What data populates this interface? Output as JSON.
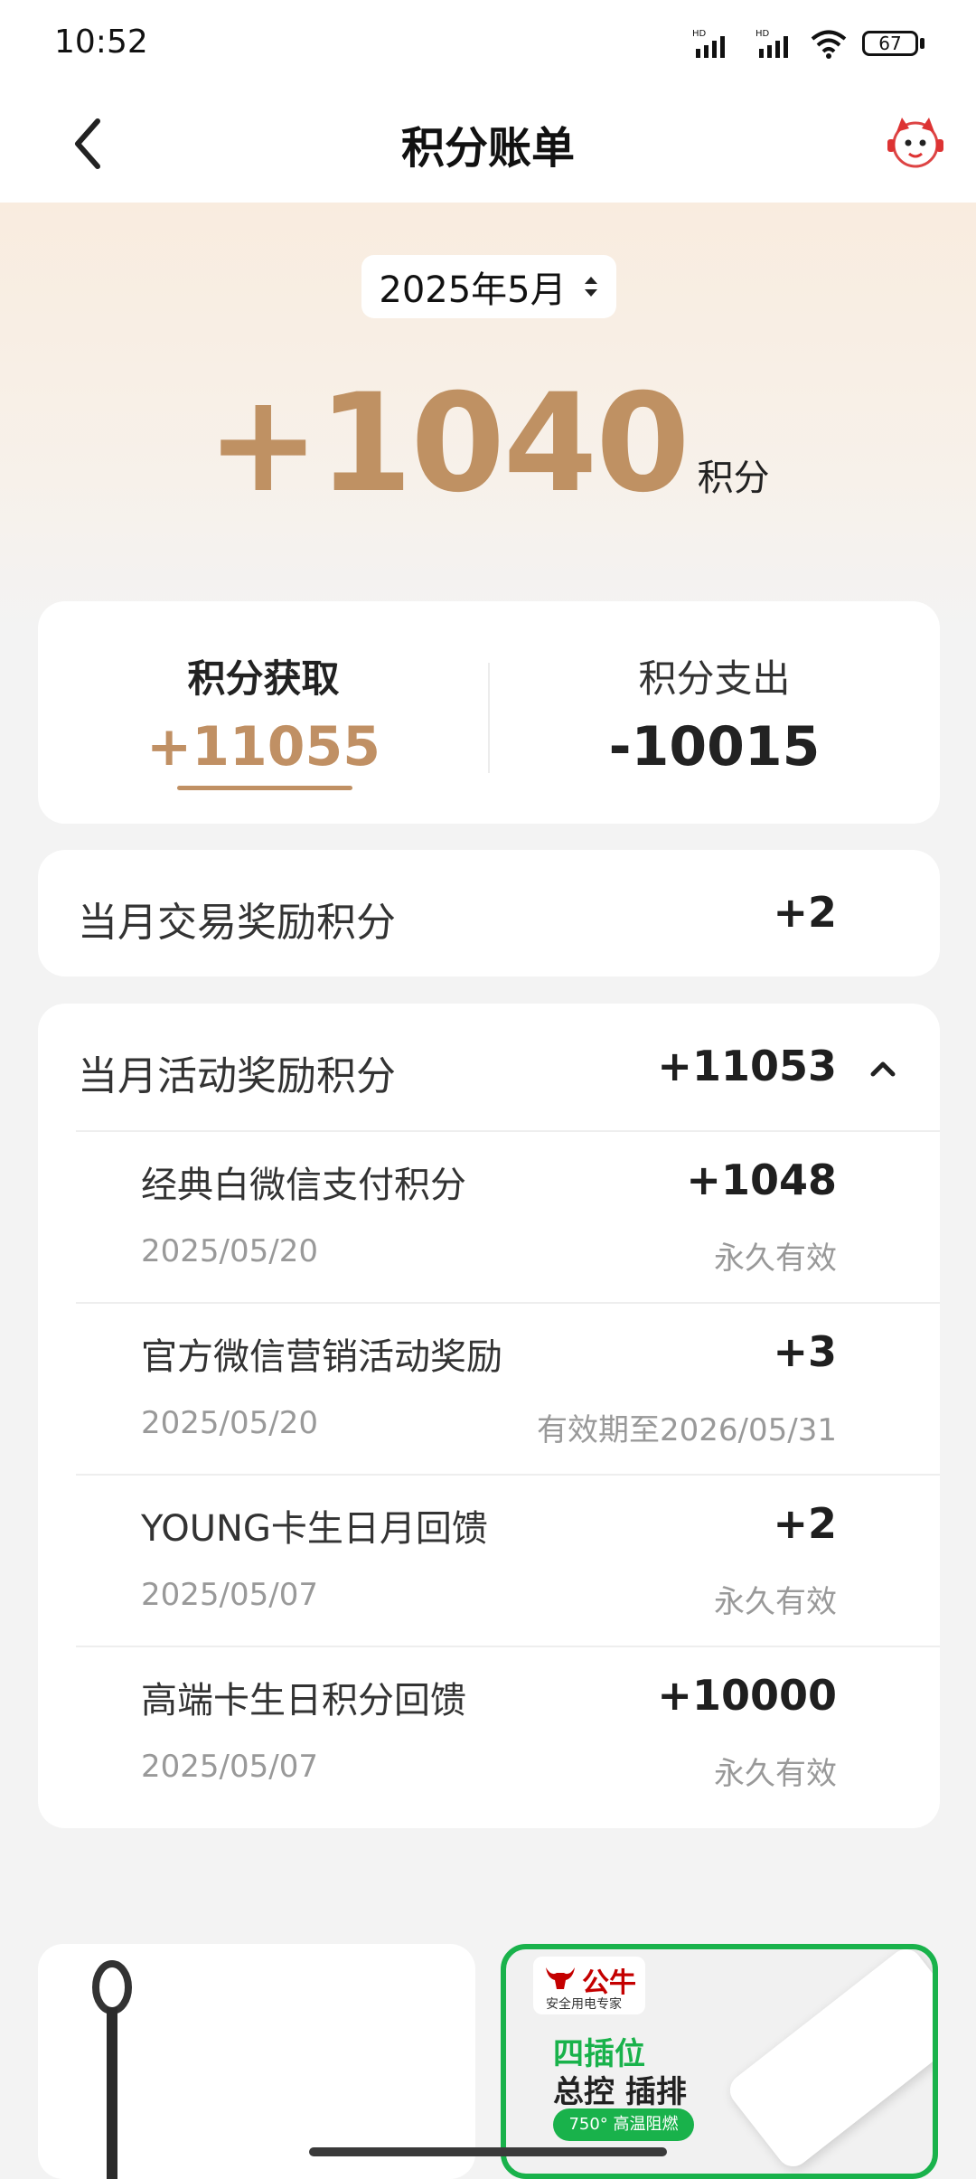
{
  "status": {
    "time": "10:52",
    "battery": "67"
  },
  "header": {
    "title": "积分账单"
  },
  "month": {
    "label": "2025年5月"
  },
  "total": {
    "value": "+1040",
    "unit": "积分"
  },
  "summary": {
    "earn_label": "积分获取",
    "earn_value": "+11055",
    "spend_label": "积分支出",
    "spend_value": "-10015"
  },
  "trade": {
    "label": "当月交易奖励积分",
    "value": "+2"
  },
  "activity": {
    "label": "当月活动奖励积分",
    "value": "+11053",
    "items": [
      {
        "title": "经典白微信支付积分",
        "points": "+1048",
        "date": "2025/05/20",
        "validity": "永久有效"
      },
      {
        "title": "官方微信营销活动奖励",
        "points": "+3",
        "date": "2025/05/20",
        "validity": "有效期至2026/05/31"
      },
      {
        "title": "YOUNG卡生日月回馈",
        "points": "+2",
        "date": "2025/05/07",
        "validity": "永久有效"
      },
      {
        "title": "高端卡生日积分回馈",
        "points": "+10000",
        "date": "2025/05/07",
        "validity": "永久有效"
      }
    ]
  },
  "ad": {
    "brand": "公牛",
    "brand_tagline": "安全用电专家",
    "line1": "四插位",
    "line2": "总控 插排",
    "badge": "750° 高温阻燃"
  },
  "colors": {
    "accent": "#bf9163",
    "ad_green": "#19b24b"
  }
}
